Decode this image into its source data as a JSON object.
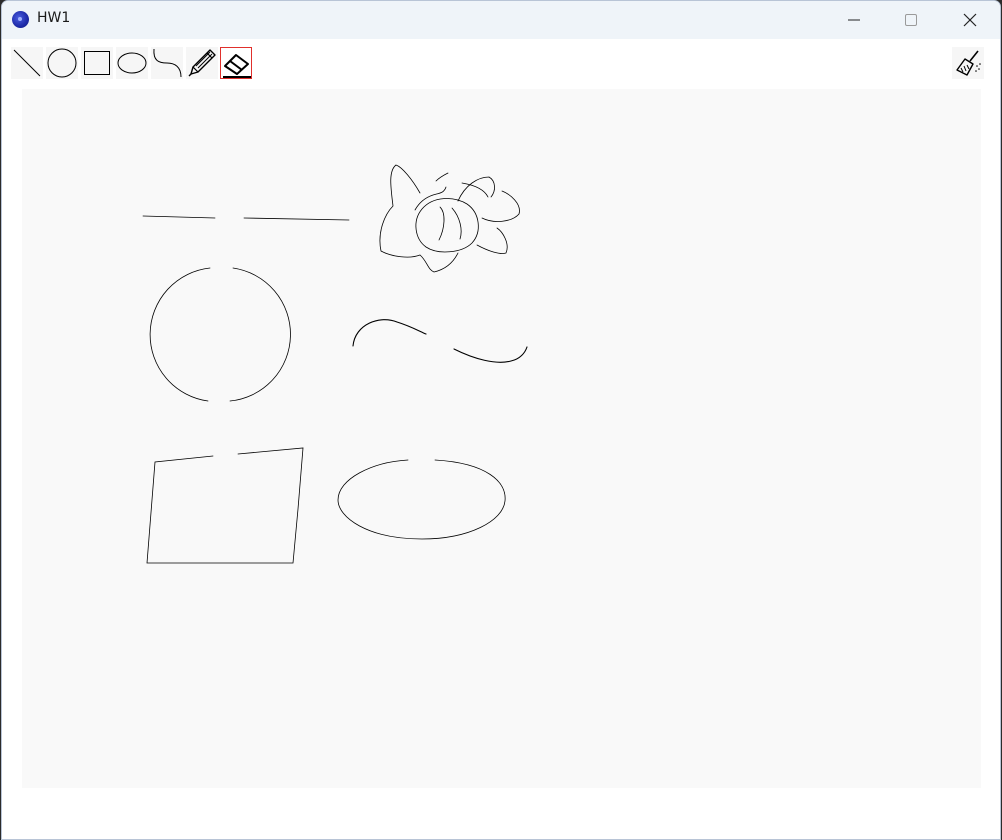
{
  "window": {
    "title": "HW1",
    "app_icon": "app-orb-icon",
    "controls": {
      "minimize_icon": "minimize-icon",
      "maximize_icon": "maximize-icon",
      "close_icon": "close-icon"
    }
  },
  "toolbar": {
    "tools": [
      {
        "id": "line",
        "icon": "line-icon",
        "selected": false
      },
      {
        "id": "circle",
        "icon": "circle-icon",
        "selected": false
      },
      {
        "id": "rectangle",
        "icon": "rectangle-icon",
        "selected": false
      },
      {
        "id": "ellipse",
        "icon": "ellipse-icon",
        "selected": false
      },
      {
        "id": "curve",
        "icon": "curve-icon",
        "selected": false
      },
      {
        "id": "pencil",
        "icon": "pencil-icon",
        "selected": false
      },
      {
        "id": "eraser",
        "icon": "eraser-icon",
        "selected": true
      }
    ],
    "clear_icon": "broom-icon"
  },
  "colors": {
    "selected_border": "#e0302c",
    "canvas_bg": "#f9f9f9",
    "titlebar_bg": "#eff4f9",
    "stroke": "#000000"
  }
}
